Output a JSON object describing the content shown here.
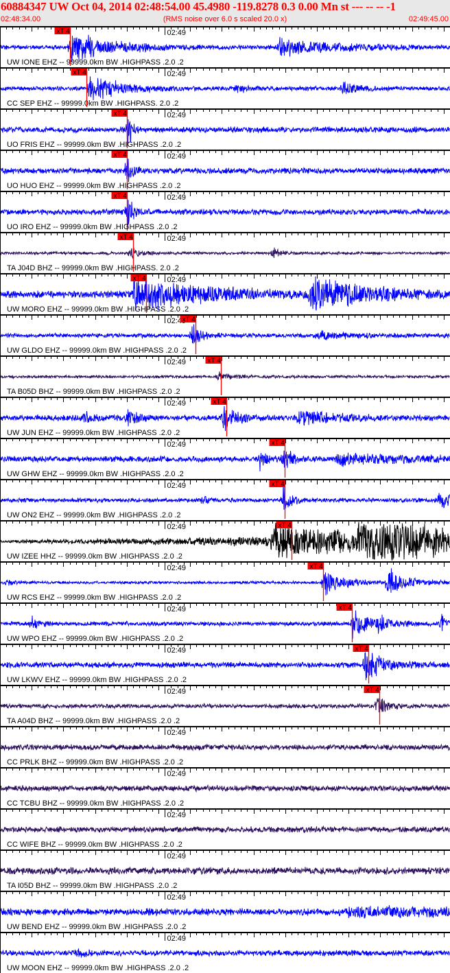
{
  "header": {
    "title": "60884347 UW Oct 04, 2014 02:48:54.00   45.4980 -119.8278  0.3 0.00 Mn st --- -- --   -1",
    "start_time": "02:48:34.00",
    "end_time": "02:49:45.00",
    "note": "(RMS noise over 6.0 s scaled 20.0 x)"
  },
  "chart_data": {
    "type": "line",
    "title": "Seismogram record section",
    "x_range_seconds": [
      0,
      71
    ],
    "x_origin": "02:48:34.00",
    "minute_tick_label": "02:49",
    "minute_tick_seconds": 26,
    "pick_label": "xT 4",
    "colors": {
      "EHZ": "#0000ff",
      "BHZ": "#2a0f5c",
      "HHZ": "#000000",
      "pick": "#ff0000"
    },
    "traces": [
      {
        "label": "UW IONE EHZ -- 99999.0km BW .HIGHPASS .2.0 .2",
        "comp": "EHZ",
        "pick": 11.0,
        "noise": 3,
        "events": [
          [
            11,
            26,
            6
          ],
          [
            44,
            14,
            9
          ]
        ]
      },
      {
        "label": "CC SEP EHZ -- 99999.0km BW .HIGHPASS. 2.0 .2",
        "comp": "EHZ",
        "pick": 13.6,
        "noise": 3,
        "events": [
          [
            14,
            22,
            5
          ],
          [
            37,
            6,
            2
          ],
          [
            54,
            13,
            2
          ]
        ]
      },
      {
        "label": "UO FRIS EHZ -- 99999.0km BW .HIGHPASS .2.0 .2",
        "comp": "EHZ",
        "pick": 20.0,
        "noise": 4,
        "events": [
          [
            20,
            36,
            0.7
          ]
        ]
      },
      {
        "label": "UO HUO EHZ -- 99999.0km BW .HIGHPASS .2.0 .2",
        "comp": "EHZ",
        "pick": 20.0,
        "noise": 4,
        "events": [
          [
            20,
            36,
            0.7
          ]
        ]
      },
      {
        "label": "UO IRO EHZ -- 99999.0km BW .HIGHPASS .2.0 .2",
        "comp": "EHZ",
        "pick": 20.0,
        "noise": 4,
        "events": [
          [
            20,
            36,
            0.7
          ]
        ]
      },
      {
        "label": "TA J04D BHZ -- 99999.0km BW .HIGHPASS. 2.0 .2",
        "comp": "BHZ",
        "pick": 21.0,
        "noise": 2,
        "events": [
          [
            20.5,
            12,
            1.5
          ],
          [
            43,
            12,
            1
          ]
        ]
      },
      {
        "label": "UW MORO EHZ -- 99999.0km BW .HIGHPASS .2.0 .2",
        "comp": "EHZ",
        "pick": 23.0,
        "noise": 5,
        "events": [
          [
            21,
            30,
            10
          ],
          [
            49,
            30,
            8
          ]
        ]
      },
      {
        "label": "UW GLDO EHZ -- 99999.0km BW .HIGHPASS .2.0 .2",
        "comp": "EHZ",
        "pick": 30.9,
        "noise": 3,
        "events": [
          [
            30.2,
            22,
            1.5
          ],
          [
            50,
            7,
            5
          ]
        ]
      },
      {
        "label": "TA B05D BHZ -- 99999.0km BW .HIGHPASS .2.0 .2",
        "comp": "BHZ",
        "pick": 34.8,
        "noise": 2,
        "events": [
          [
            34.3,
            8,
            2
          ]
        ]
      },
      {
        "label": "UW JUN EHZ -- 99999.0km BW .HIGHPASS .2.0 .2",
        "comp": "EHZ",
        "pick": 35.7,
        "noise": 4,
        "events": [
          [
            13,
            10,
            2
          ],
          [
            20,
            14,
            1.5
          ],
          [
            35.2,
            26,
            2
          ],
          [
            47,
            16,
            5
          ]
        ]
      },
      {
        "label": "UW GHW EHZ -- 99999.0km BW .HIGHPASS .2.0 .2",
        "comp": "EHZ",
        "pick": 44.9,
        "noise": 4,
        "events": [
          [
            41,
            15,
            1
          ],
          [
            44.6,
            26,
            1
          ],
          [
            53,
            9,
            12
          ]
        ]
      },
      {
        "label": "UW ON2 EHZ -- 99999.0km BW .HIGHPASS .2.0 .2",
        "comp": "EHZ",
        "pick": 44.9,
        "noise": 3,
        "events": [
          [
            32,
            8,
            0.6
          ],
          [
            44.6,
            30,
            1
          ],
          [
            69,
            18,
            2
          ]
        ]
      },
      {
        "label": "UW IZEE HHZ -- 99999.0km BW .HIGHPASS .2.0 .2",
        "comp": "HHZ",
        "pick": 46.0,
        "noise": 5,
        "ramp": true,
        "events": [
          [
            43,
            28,
            12
          ],
          [
            56.5,
            34,
            14
          ]
        ]
      },
      {
        "label": "UW RCS EHZ -- 99999.0km BW .HIGHPASS .2.0 .2",
        "comp": "EHZ",
        "pick": 51.0,
        "noise": 2,
        "events": [
          [
            1,
            7,
            1
          ],
          [
            51,
            26,
            3
          ],
          [
            61,
            26,
            3
          ]
        ]
      },
      {
        "label": "UW WPO EHZ -- 99999.0km BW .HIGHPASS .2.0 .2",
        "comp": "EHZ",
        "pick": 55.5,
        "noise": 3,
        "events": [
          [
            5,
            10,
            1
          ],
          [
            55.5,
            22,
            3
          ],
          [
            59.5,
            18,
            1
          ],
          [
            69.5,
            16,
            1
          ]
        ]
      },
      {
        "label": "UW LKWV EHZ -- 99999.0km BW .HIGHPASS .2.0 .2",
        "comp": "EHZ",
        "pick": 58.1,
        "noise": 4,
        "events": [
          [
            57.5,
            28,
            3
          ]
        ]
      },
      {
        "label": "TA A04D BHZ -- 99999.0km BW .HIGHPASS .2.0 .2",
        "comp": "BHZ",
        "pick": 59.8,
        "noise": 3,
        "events": [
          [
            59.5,
            15,
            1.5
          ]
        ]
      },
      {
        "label": "CC PRLK BHZ -- 99999.0km BW .HIGHPASS .2.0 .2",
        "comp": "BHZ",
        "noise": 4,
        "events": []
      },
      {
        "label": "CC TCBU BHZ -- 99999.0km BW .HIGHPASS .2.0 .2",
        "comp": "BHZ",
        "noise": 4,
        "events": []
      },
      {
        "label": "CC WIFE BHZ -- 99999.0km BW .HIGHPASS .2.0 .2",
        "comp": "BHZ",
        "noise": 4,
        "events": []
      },
      {
        "label": "TA I05D BHZ -- 99999.0km BW .HIGHPASS .2.0 .2",
        "comp": "BHZ",
        "noise": 5,
        "events": []
      },
      {
        "label": "UW BEND EHZ -- 99999.0km BW .HIGHPASS .2.0 .2",
        "comp": "EHZ",
        "noise": 5,
        "events": [
          [
            55,
            8,
            16
          ]
        ]
      },
      {
        "label": "UW MOON EHZ -- 99999.0km BW .HIGHPASS .2.0 .2",
        "comp": "EHZ",
        "noise": 4,
        "events": [
          [
            12,
            6,
            2
          ]
        ]
      }
    ]
  }
}
